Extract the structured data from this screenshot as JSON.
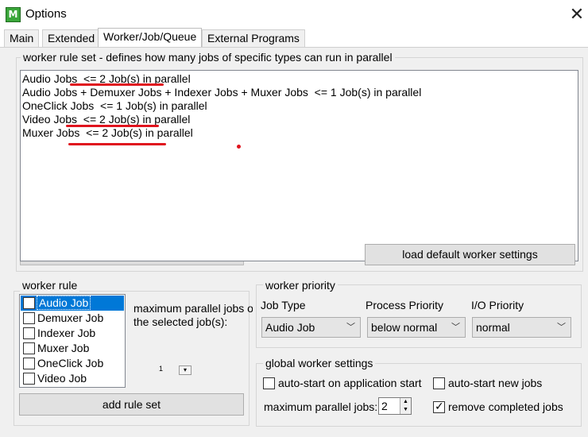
{
  "window": {
    "title": "Options",
    "icon_text": "M",
    "close_symbol": "✕"
  },
  "tabs": [
    {
      "label": "Main",
      "active": false
    },
    {
      "label": "Extended",
      "active": false
    },
    {
      "label": "Worker/Job/Queue",
      "active": true
    },
    {
      "label": "External Programs",
      "active": false
    }
  ],
  "rule_set": {
    "group_label": "worker rule set - defines how many jobs of specific types can run in parallel",
    "lines": [
      "Audio Jobs  <= 2 Job(s) in parallel",
      "Audio Jobs + Demuxer Jobs + Indexer Jobs + Muxer Jobs  <= 1 Job(s) in parallel",
      "OneClick Jobs  <= 1 Job(s) in parallel",
      "Video Jobs  <= 2 Job(s) in parallel",
      "Muxer Jobs  <= 2 Job(s) in parallel"
    ],
    "load_default_label": "load default worker settings"
  },
  "worker_rule": {
    "group_label": "worker rule",
    "items": [
      {
        "label": "Audio Job",
        "checked": false,
        "selected": true
      },
      {
        "label": "Demuxer Job",
        "checked": false,
        "selected": false
      },
      {
        "label": "Indexer Job",
        "checked": false,
        "selected": false
      },
      {
        "label": "Muxer Job",
        "checked": false,
        "selected": false
      },
      {
        "label": "OneClick Job",
        "checked": false,
        "selected": false
      },
      {
        "label": "Video Job",
        "checked": false,
        "selected": false
      }
    ],
    "max_parallel_line1": "maximum parallel jobs o",
    "max_parallel_line2": "the selected job(s):",
    "small_spinner_value": "1",
    "small_spinner_arrow": "▾",
    "add_rule_label": "add rule set"
  },
  "worker_priority": {
    "group_label": "worker priority",
    "job_type_label": "Job Type",
    "process_priority_label": "Process Priority",
    "io_priority_label": "I/O Priority",
    "job_type_value": "Audio Job",
    "process_priority_value": "below normal",
    "io_priority_value": "normal",
    "chevron": "﹀"
  },
  "global_worker": {
    "group_label": "global worker settings",
    "autostart_app_label": "auto-start on application start",
    "autostart_app_checked": false,
    "autostart_new_label": "auto-start new jobs",
    "autostart_new_checked": false,
    "max_parallel_label": "maximum parallel jobs:",
    "max_parallel_value": "2",
    "spin_up": "▲",
    "spin_down": "▼",
    "remove_completed_label": "remove completed jobs",
    "remove_completed_checked": true
  },
  "annotation_color": "#e0141e"
}
